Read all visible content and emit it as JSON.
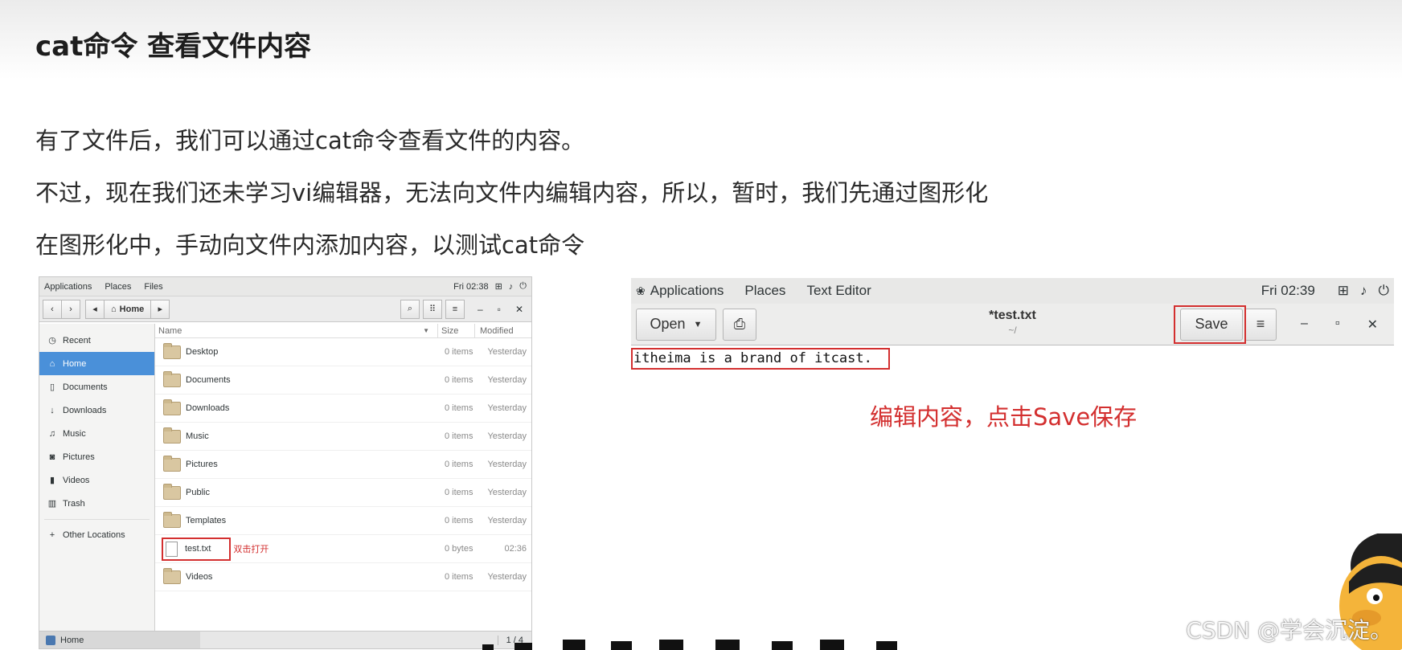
{
  "page": {
    "title": "cat命令 查看文件内容",
    "paragraphs": [
      "有了文件后，我们可以通过cat命令查看文件的内容。",
      "不过，现在我们还未学习vi编辑器，无法向文件内编辑内容，所以，暂时，我们先通过图形化",
      "在图形化中，手动向文件内添加内容，以测试cat命令"
    ]
  },
  "files_window": {
    "topbar": {
      "applications": "Applications",
      "places": "Places",
      "files": "Files",
      "time": "Fri 02:38"
    },
    "location": "Home",
    "sidebar": [
      {
        "label": "Recent",
        "icon": "clock-icon"
      },
      {
        "label": "Home",
        "icon": "home-icon",
        "active": true
      },
      {
        "label": "Documents",
        "icon": "document-icon"
      },
      {
        "label": "Downloads",
        "icon": "download-icon"
      },
      {
        "label": "Music",
        "icon": "music-icon"
      },
      {
        "label": "Pictures",
        "icon": "camera-icon"
      },
      {
        "label": "Videos",
        "icon": "video-icon"
      },
      {
        "label": "Trash",
        "icon": "trash-icon"
      },
      {
        "label": "Other Locations",
        "icon": "plus-icon"
      }
    ],
    "columns": {
      "name": "Name",
      "size": "Size",
      "modified": "Modified"
    },
    "rows": [
      {
        "name": "Desktop",
        "size": "0 items",
        "modified": "Yesterday"
      },
      {
        "name": "Documents",
        "size": "0 items",
        "modified": "Yesterday"
      },
      {
        "name": "Downloads",
        "size": "0 items",
        "modified": "Yesterday"
      },
      {
        "name": "Music",
        "size": "0 items",
        "modified": "Yesterday"
      },
      {
        "name": "Pictures",
        "size": "0 items",
        "modified": "Yesterday"
      },
      {
        "name": "Public",
        "size": "0 items",
        "modified": "Yesterday"
      },
      {
        "name": "Templates",
        "size": "0 items",
        "modified": "Yesterday"
      },
      {
        "name": "test.txt",
        "size": "0 bytes",
        "modified": "02:36"
      },
      {
        "name": "Videos",
        "size": "0 items",
        "modified": "Yesterday"
      }
    ],
    "annotation": "双击打开",
    "status": {
      "location": "Home",
      "page": "1 / 4"
    }
  },
  "editor_window": {
    "topbar": {
      "applications": "Applications",
      "places": "Places",
      "app": "Text Editor",
      "time": "Fri 02:39"
    },
    "open_label": "Open",
    "title": "*test.txt",
    "subtitle": "~/",
    "save_label": "Save",
    "content": "itheima is a brand of itcast.",
    "annotation": "编辑内容，点击Save保存"
  },
  "watermark": "CSDN @学会沉淀。",
  "colors": {
    "annotation_red": "#d32f2f",
    "selection_blue": "#4a90d9"
  }
}
